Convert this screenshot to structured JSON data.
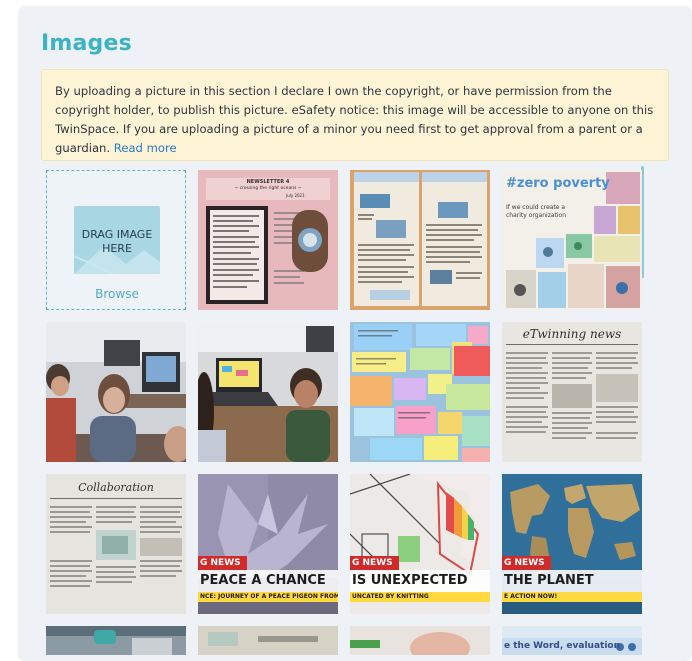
{
  "section": {
    "title": "Images"
  },
  "notice": {
    "text": "By uploading a picture in this section I declare I own the copyright, or have permission from the copyright holder, to publish this picture. eSafety notice: this image will be accessible to anyone on this TwinSpace. If you are uploading a picture of a minor you need first to get approval from a parent or a guardian.",
    "link": "Read more"
  },
  "upload": {
    "drag_line1": "DRAG IMAGE",
    "drag_line2": "HERE",
    "browse": "Browse"
  },
  "thumbnails": {
    "newsletter_title": "NEWSLETTER 4",
    "newsletter_sub": "~ crossing the right oceans ~",
    "newsletter_date": "July 2021",
    "zero_poverty": "#zero poverty",
    "zero_sub": "If we could create a charity organization",
    "twinning_news": "eTwinning news",
    "collaboration": "Collaboration",
    "news_tag": "G NEWS",
    "peace_title": "PEACE A CHANCE",
    "peace_sub": "NCE: JOURNEY OF A PEACE PIGEON FROM THE STRETCH TO",
    "unexpected_title": "IS UNEXPECTED",
    "unexpected_sub": "UNCATED BY KNITTING",
    "planet_title": "THE PLANET",
    "planet_sub": "E ACTION NOW!",
    "evaluation": "e the Word, evaluation"
  },
  "colors": {
    "accent": "#3bb3c3",
    "notice_bg": "#fdf4d6",
    "link": "#2a7ac7",
    "news_red": "#d02a2a"
  }
}
